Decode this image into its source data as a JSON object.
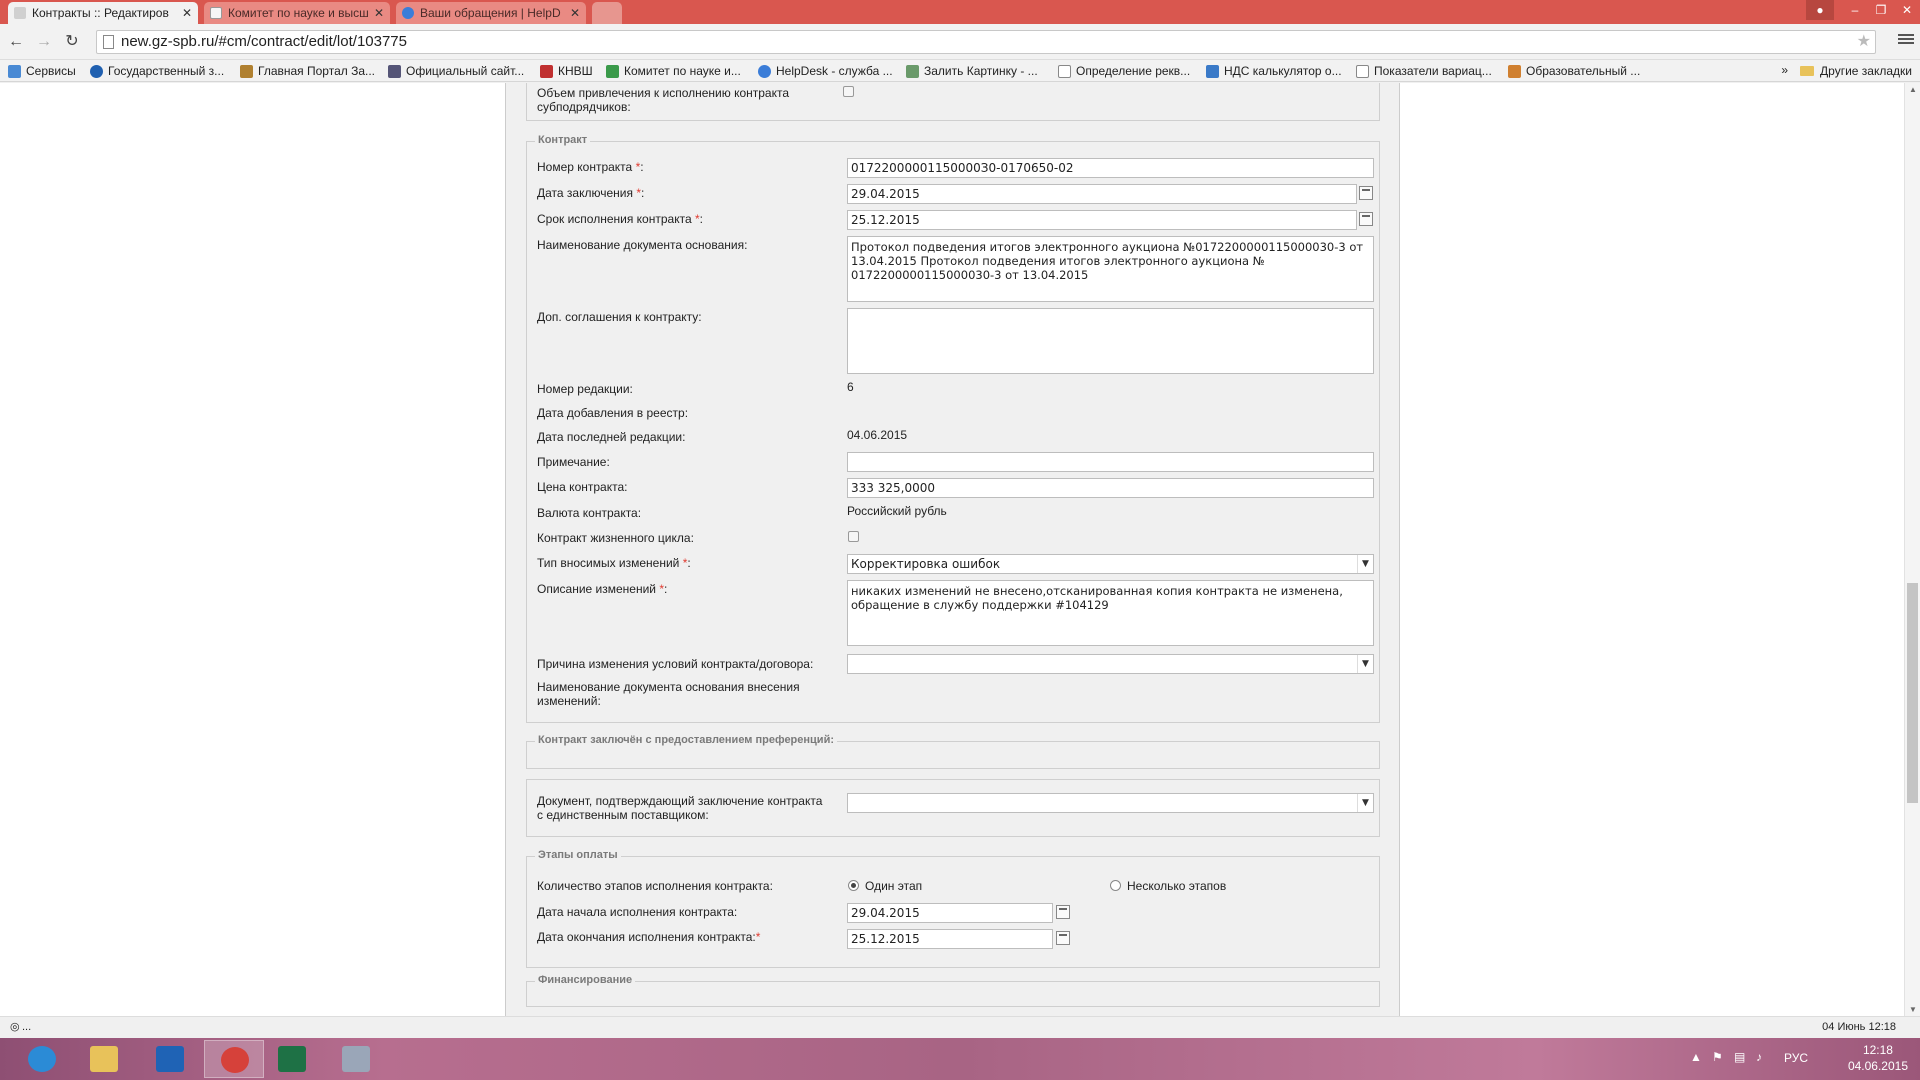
{
  "browser": {
    "tabs": [
      {
        "label": "Контракты :: Редактиров",
        "active": true
      },
      {
        "label": "Комитет по науке и высш",
        "active": false
      },
      {
        "label": "Ваши обращения | HelpD",
        "active": false
      }
    ],
    "url": "new.gz-spb.ru/#cm/contract/edit/lot/103775",
    "bookmarks": [
      "Сервисы",
      "Государственный з...",
      "Главная Портал За...",
      "Официальный сайт...",
      "КНВШ",
      "Комитет по науке и...",
      "HelpDesk - служба ...",
      "Залить Картинку - ...",
      "Определение рекв...",
      "НДС калькулятор о...",
      "Показатели вариац...",
      "Образовательный ..."
    ],
    "bookmarks_more": "»",
    "other_bookmarks": "Другие закладки",
    "status_text": "...",
    "status_right": "04 Июнь 12:18"
  },
  "top_partial": {
    "label_line1": "Объем привлечения к исполнению контракта",
    "label_line2": "субподрядчиков:"
  },
  "contract": {
    "legend": "Контракт",
    "required_mark": "*",
    "number_label": "Номер контракта",
    "number_value": "01722000001150000З0-0170650-02",
    "date_label": "Дата заключения",
    "date_value": "29.04.2015",
    "term_label": "Срок исполнения контракта",
    "term_value": "25.12.2015",
    "basis_label": "Наименование документа основания:",
    "basis_value": " Протокол подведения итогов электронного аукциона №0172200000115000030-3  от 13.04.2015 Протокол подведения итогов электронного аукциона № 0172200000115000030-3 от 13.04.2015",
    "addenda_label": "Доп. соглашения к контракту:",
    "addenda_value": "",
    "revision_label": "Номер редакции:",
    "revision_value": "6",
    "added_label": "Дата добавления в реестр:",
    "added_value": "",
    "last_edit_label": "Дата последней редакции:",
    "last_edit_value": "04.06.2015",
    "note_label": "Примечание:",
    "note_value": "",
    "price_label": "Цена контракта:",
    "price_value": "333 325,0000",
    "currency_label": "Валюта контракта:",
    "currency_value": "Российский рубль",
    "lifecycle_label": "Контракт жизненного цикла:",
    "change_type_label": "Тип вносимых изменений",
    "change_type_value": "Корректировка ошибок",
    "change_desc_label": "Описание изменений",
    "change_desc_value": "никаких изменений не внесено,отсканированная копия контракта не изменена, обращение в службу поддержки #104129",
    "reason_label": "Причина изменения условий контракта/договора:",
    "reason_value": "",
    "change_doc_label_1": "Наименование документа основания внесения",
    "change_doc_label_2": "изменений:"
  },
  "preferences": {
    "legend": "Контракт заключён с предоставлением преференций:"
  },
  "single_supplier": {
    "label_1": "Документ, подтверждающий заключение контракта",
    "label_2": "с единственным поставщиком:",
    "value": ""
  },
  "payment": {
    "legend": "Этапы оплаты",
    "stages_label": "Количество этапов исполнения контракта:",
    "option_one": "Один этап",
    "option_many": "Несколько этапов",
    "start_label": "Дата начала исполнения контракта:",
    "start_value": "29.04.2015",
    "end_label": "Дата окончания исполнения контракта:",
    "end_value": "25.12.2015",
    "required_mark": "*"
  },
  "financing": {
    "legend": "Финансирование"
  },
  "taskbar": {
    "tray_lang": "РУС",
    "clock_time": "12:18",
    "clock_date": "04.06.2015"
  },
  "colors": {
    "tab_strip": "#d9574f",
    "required": "#e03a2f",
    "taskbar": "#b3668a"
  }
}
